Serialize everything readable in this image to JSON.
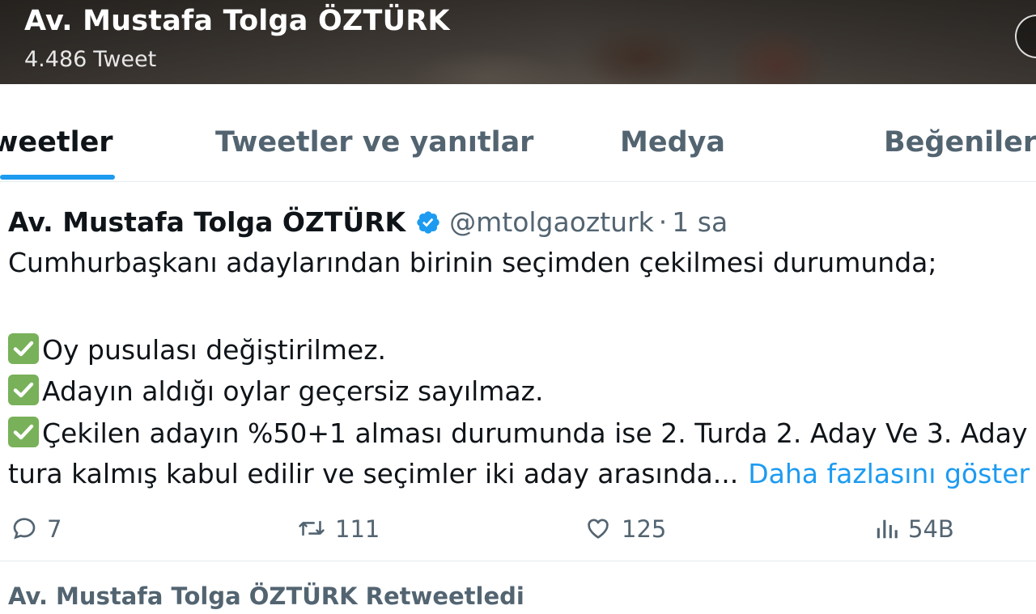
{
  "profile": {
    "name": "Av. Mustafa Tolga ÖZTÜRK",
    "tweet_count": "4.486",
    "tweet_count_label": "Tweet"
  },
  "tabs": [
    {
      "label": "Tweetler",
      "active": true
    },
    {
      "label": "Tweetler ve yanıtlar",
      "active": false
    },
    {
      "label": "Medya",
      "active": false
    },
    {
      "label": "Beğeniler",
      "active": false
    }
  ],
  "tweet": {
    "author_name": "Av. Mustafa Tolga ÖZTÜRK",
    "verified_icon": "verified-badge-icon",
    "handle": "@mtolgaozturk",
    "separator": "·",
    "time": "1 sa",
    "lines": [
      "Cumhurbaşkanı adaylarından birinin seçimden çekilmesi durumunda;",
      "Oy pusulası değiştirilmez.",
      "Adayın aldığı oylar geçersiz sayılmaz.",
      "Çekilen adayın %50+1 alması durumunda ise 2. Turda 2. Aday Ve 3. Aday",
      "tura kalmış kabul edilir ve seçimler iki aday arasında..."
    ],
    "more_link": "Daha fazlasını göster",
    "check_icon": "check-mark-button-icon",
    "stats": {
      "replies": "7",
      "retweets": "111",
      "likes": "125",
      "views": "54B"
    }
  },
  "retweet_notice": "Av. Mustafa Tolga ÖZTÜRK Retweetledi",
  "colors": {
    "accent": "#1d9bf0",
    "text": "#0f1419",
    "secondary": "#536471",
    "check_green": "#78b159"
  }
}
